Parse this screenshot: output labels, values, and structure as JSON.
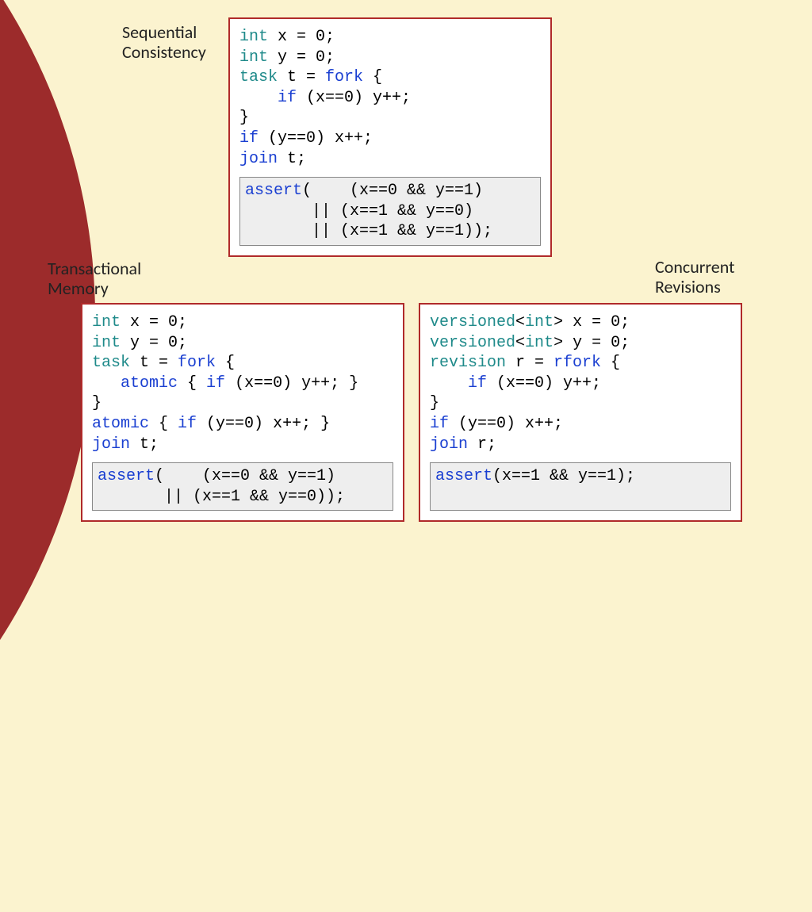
{
  "labels": {
    "seq": "Sequential\nConsistency",
    "trans": "Transactional\nMemory",
    "conc": "Concurrent\nRevisions"
  },
  "seq": {
    "l1a": "int",
    "l1b": " x = 0;",
    "l2a": "int",
    "l2b": " y = 0;",
    "l3a": "task",
    "l3b": " t = ",
    "l3c": "fork",
    "l3d": " {",
    "l4a": "    if",
    "l4b": " (x==0) y++;",
    "l5": "}",
    "l6a": "if",
    "l6b": " (y==0) x++;",
    "l7a": "join",
    "l7b": " t;",
    "a1a": "assert",
    "a1b": "(    (x==0 && y==1)",
    "a2": "       || (x==1 && y==0)",
    "a3": "       || (x==1 && y==1));"
  },
  "trans": {
    "l1a": "int",
    "l1b": " x = 0;",
    "l2a": "int",
    "l2b": " y = 0;",
    "l3a": "task",
    "l3b": " t = ",
    "l3c": "fork",
    "l3d": " {",
    "l4a": "   atomic",
    "l4b": " { ",
    "l4c": "if",
    "l4d": " (x==0) y++; }",
    "l5": "}",
    "l6a": "atomic",
    "l6b": " { ",
    "l6c": "if",
    "l6d": " (y==0) x++; }",
    "l7a": "join",
    "l7b": " t;",
    "a1a": "assert",
    "a1b": "(    (x==0 && y==1)",
    "a2": "       || (x==1 && y==0));"
  },
  "conc": {
    "l1a": "versioned",
    "l1b": "<",
    "l1c": "int",
    "l1d": "> x = 0;",
    "l2a": "versioned",
    "l2b": "<",
    "l2c": "int",
    "l2d": "> y = 0;",
    "l3a": "revision",
    "l3b": " r = ",
    "l3c": "rfork",
    "l3d": " {",
    "l4a": "    if",
    "l4b": " (x==0) y++;",
    "l5": "}",
    "l6a": "if",
    "l6b": " (y==0) x++;",
    "l7a": "join",
    "l7b": " r;",
    "a1a": "assert",
    "a1b": "(x==1 && y==1);"
  }
}
